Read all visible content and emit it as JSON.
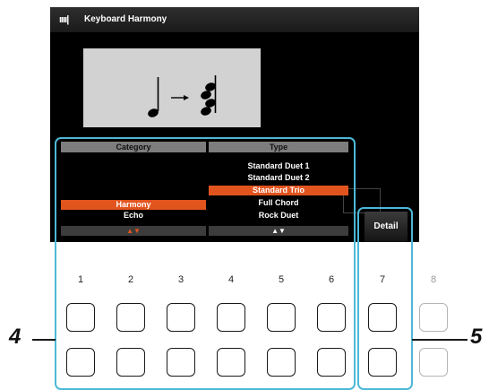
{
  "screen": {
    "title_icon": "ıııı|",
    "title": "Keyboard Harmony"
  },
  "category": {
    "header": "Category",
    "items": [
      "Harmony",
      "Echo"
    ],
    "selected": "Harmony",
    "arrows": "▲▼"
  },
  "type": {
    "header": "Type",
    "items": [
      "Standard Duet 1",
      "Standard Duet 2",
      "Standard Trio",
      "Full Chord",
      "Rock Duet"
    ],
    "selected": "Standard Trio",
    "arrows": "▲▼"
  },
  "detail_label": "Detail",
  "buttons": {
    "numbers": [
      "1",
      "2",
      "3",
      "4",
      "5",
      "6",
      "7",
      "8"
    ]
  },
  "callouts": {
    "left": "4",
    "right": "5"
  },
  "colors": {
    "screen_bg": "#000000",
    "selected_highlight": "#e2541e",
    "frame_highlight": "#4db8d8",
    "arrow_active": "#e2541e",
    "arrow_neutral": "#ffffff"
  },
  "icons": [
    "keyboard-harmony-icon",
    "quarter-note-icon",
    "arrow-right-icon",
    "chord-notes-icon"
  ]
}
